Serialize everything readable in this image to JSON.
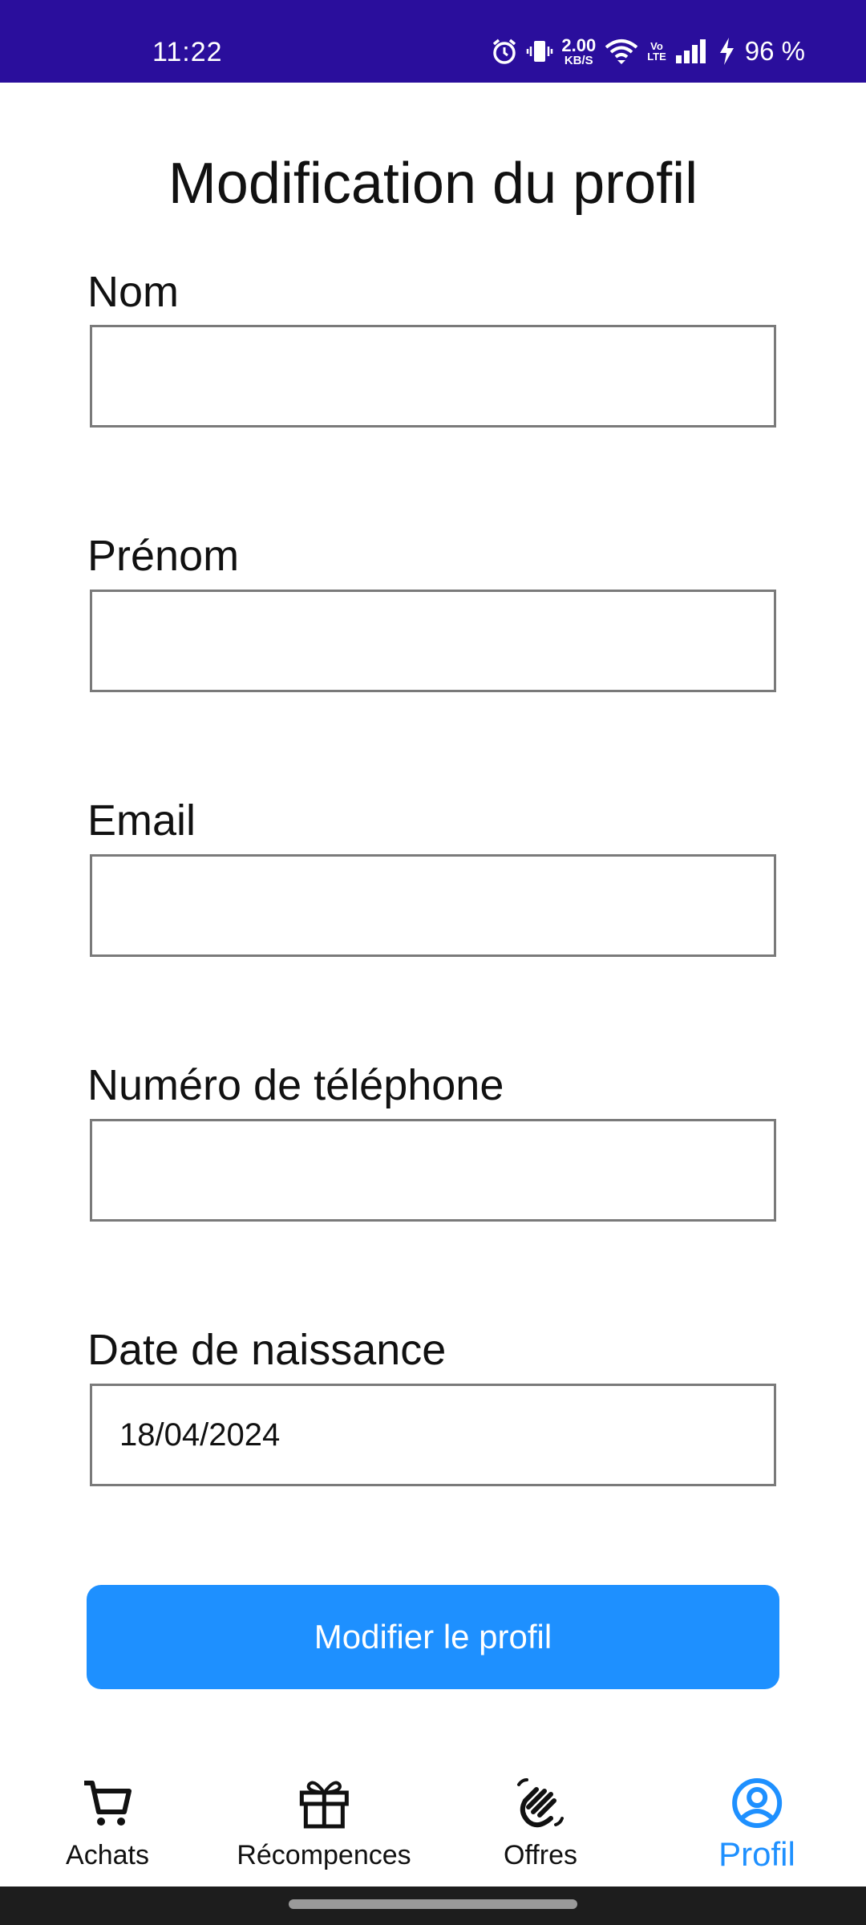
{
  "status_bar": {
    "time": "11:22",
    "net_speed_value": "2.00",
    "net_speed_unit": "KB/S",
    "volte_top": "Vo",
    "volte_bottom": "LTE",
    "battery": "96 %",
    "icons": [
      "alarm-icon",
      "vibrate-icon",
      "wifi-icon",
      "volte-icon",
      "signal-icon",
      "charging-icon"
    ],
    "background": "#2a0e9c"
  },
  "page": {
    "title": "Modification du profil"
  },
  "form": {
    "fields": [
      {
        "label": "Nom",
        "value": ""
      },
      {
        "label": "Prénom",
        "value": ""
      },
      {
        "label": "Email",
        "value": ""
      },
      {
        "label": "Numéro de téléphone",
        "value": ""
      },
      {
        "label": "Date de naissance",
        "value": "18/04/2024"
      }
    ],
    "submit_label": "Modifier le profil",
    "accent": "#1e90ff"
  },
  "bottom_nav": {
    "items": [
      {
        "label": "Achats",
        "icon": "cart-icon",
        "active": false
      },
      {
        "label": "Récompences",
        "icon": "gift-icon",
        "active": false
      },
      {
        "label": "Offres",
        "icon": "hand-wave-icon",
        "active": false
      },
      {
        "label": "Profil",
        "icon": "account-circle-icon",
        "active": true
      }
    ]
  }
}
